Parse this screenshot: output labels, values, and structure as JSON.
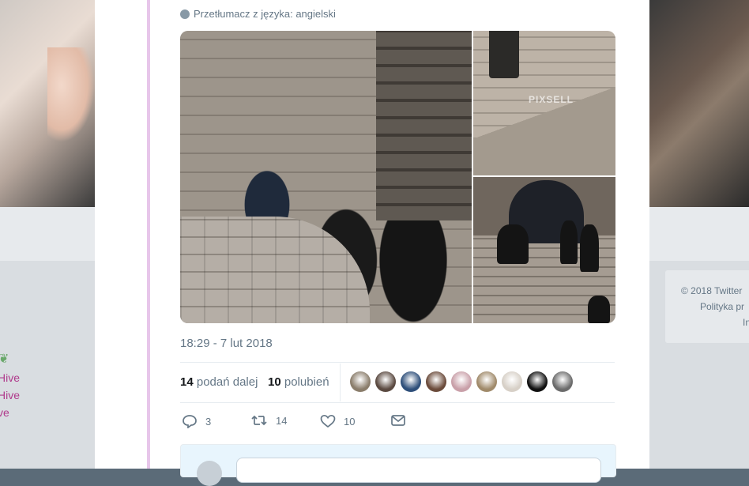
{
  "translate": {
    "label": "Przetłumacz z języka: angielski"
  },
  "media": {
    "watermark": "PIXSELL"
  },
  "timestamp": "18:29 - 7 lut 2018",
  "stats": {
    "retweets_count": "14",
    "retweets_label": "podań dalej",
    "likes_count": "10",
    "likes_label": "polubień"
  },
  "avatar_colors": [
    "#8a7d6b",
    "#5b4a41",
    "#2e4f7a",
    "#6b4b3b",
    "#c9a0a9",
    "#a08a6a",
    "#d7d0c7",
    "#111111",
    "#6c6c6c"
  ],
  "actions": {
    "reply_count": "3",
    "retweet_count": "14",
    "like_count": "10"
  },
  "background": {
    "left_links": [
      "Hive",
      "Hive",
      "ve"
    ],
    "footer_lines": [
      "© 2018 Twitter",
      "Polityka pr",
      "In"
    ]
  },
  "colors": {
    "accent_pink": "#e7c6ea",
    "link_purple": "#b03a8c",
    "muted_text": "#657786"
  },
  "icons": [
    "globe-icon",
    "reply-icon",
    "retweet-icon",
    "heart-icon",
    "mail-icon"
  ]
}
